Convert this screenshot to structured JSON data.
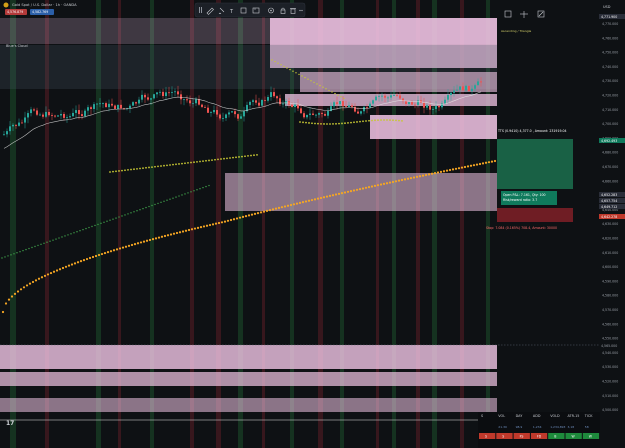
{
  "symbol": {
    "title": "Gold Spot / U.S. Dollar · 1h · OANDA",
    "sell_price": "4,576.879",
    "buy_price": "4,582.769",
    "indicator_label": "Blue's Cloud"
  },
  "toolbar": {
    "icons": [
      "drag-handle-icon",
      "pencil-icon",
      "brush-icon",
      "text-icon",
      "box-icon",
      "ruler-icon",
      "gear-icon",
      "lock-icon",
      "trash-icon",
      "more-icon"
    ]
  },
  "right_toolbar": {
    "icons": [
      "frame-icon",
      "compare-icon",
      "settings-icon"
    ]
  },
  "price_axis": {
    "currency": "USD",
    "ticks": [
      "4,770.000",
      "4,760.000",
      "4,750.000",
      "4,740.000",
      "4,730.000",
      "4,720.000",
      "4,710.000",
      "4,700.000",
      "4,690.000",
      "4,680.000",
      "4,670.000",
      "4,660.000",
      "4,650.000",
      "4,640.000",
      "4,630.000",
      "4,620.000",
      "4,610.000",
      "4,600.000",
      "4,590.000",
      "4,580.000",
      "4,570.000",
      "4,560.000",
      "4,550.000",
      "4,540.000",
      "4,530.000",
      "4,520.000",
      "4,510.000",
      "4,500.000"
    ],
    "top_tag": "4,771.900",
    "tag_green": "4,692.493",
    "tag_dark1": "4,652.283",
    "tag_dark2": "4,657.754",
    "tag_dark3": "4,649.712",
    "tag_red": "4,642.278",
    "tag_bottom": "4,565.000"
  },
  "zone_label": "Ascending / Triangle",
  "position": {
    "target_text": "TTS (0.9410) 4,377.0 , Amount: 231919.04",
    "open_pnl": "Open P&L: 7.161, Qty: 100",
    "rr": "Risk/reward ratio: 3.7",
    "stop_text": "Stop: 7.084 (0.165%) 708.4, Amount: 30000"
  },
  "stats_table": {
    "headers": [
      "S",
      "VOL",
      "DAY",
      "ADD",
      "VOLD",
      "ATR-15",
      "TICK"
    ],
    "values": [
      "",
      "21.30",
      "98.9",
      "1,234",
      "1,234,893",
      "3,18",
      "58"
    ],
    "signals": [
      {
        "label": "S",
        "color": "#c0392b"
      },
      {
        "label": "S",
        "color": "#c0392b"
      },
      {
        "label": "FS",
        "color": "#c0392b"
      },
      {
        "label": "FD",
        "color": "#c0392b"
      },
      {
        "label": "B",
        "color": "#1e8a3c"
      },
      {
        "label": "W",
        "color": "#1e8a3c"
      },
      {
        "label": "W",
        "color": "#1e8a3c"
      }
    ]
  },
  "colors": {
    "background": "#0e1114",
    "bull": "#26a69a",
    "bear": "#ef5350",
    "zone_pink": "#f3c6e6",
    "orange_ma": "#f5a623",
    "olive_ma": "#c7c734",
    "target_green": "#1b6a4a",
    "stop_red": "#7a1f26"
  }
}
